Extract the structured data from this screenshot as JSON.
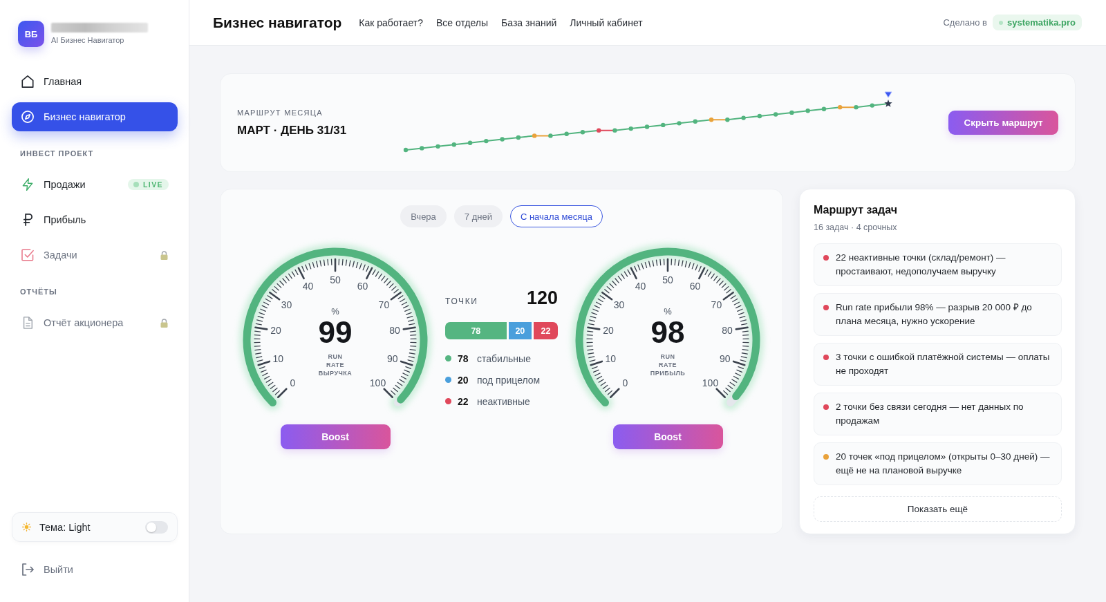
{
  "sidebar": {
    "brand": {
      "initials": "ВБ",
      "subtitle": "AI Бизнес Навигатор"
    },
    "nav": [
      {
        "label": "Главная",
        "selected": false,
        "locked": false
      },
      {
        "label": "Бизнес навигатор",
        "selected": true,
        "locked": false
      }
    ],
    "sections": [
      {
        "title": "ИНВЕСТ ПРОЕКТ",
        "items": [
          {
            "label": "Продажи",
            "selected": false,
            "locked": false,
            "badge": "LIVE"
          },
          {
            "label": "Прибыль",
            "selected": false,
            "locked": false
          },
          {
            "label": "Задачи",
            "selected": false,
            "locked": true
          }
        ]
      },
      {
        "title": "ОТЧЁТЫ",
        "items": [
          {
            "label": "Отчёт акционера",
            "selected": false,
            "locked": true
          }
        ]
      }
    ],
    "theme": {
      "label": "Тема: Light",
      "on": false
    },
    "logout": "Выйти"
  },
  "header": {
    "title": "Бизнес навигатор",
    "links": [
      "Как работает?",
      "Все отделы",
      "База знаний",
      "Личный кабинет"
    ],
    "made_by": "Сделано в",
    "site": "systematika.pro"
  },
  "route": {
    "label": "МАРШРУТ МЕСЯЦА",
    "title": "МАРТ · ДЕНЬ 31/31",
    "days": [
      {
        "color": "#52b47f",
        "current": false
      },
      {
        "color": "#52b47f",
        "current": false
      },
      {
        "color": "#52b47f",
        "current": false
      },
      {
        "color": "#52b47f",
        "current": false
      },
      {
        "color": "#52b47f",
        "current": false
      },
      {
        "color": "#52b47f",
        "current": false
      },
      {
        "color": "#52b47f",
        "current": false
      },
      {
        "color": "#52b47f",
        "current": false
      },
      {
        "color": "#e9a23b",
        "current": false
      },
      {
        "color": "#52b47f",
        "current": false
      },
      {
        "color": "#52b47f",
        "current": false
      },
      {
        "color": "#52b47f",
        "current": false
      },
      {
        "color": "#e0485b",
        "current": false
      },
      {
        "color": "#52b47f",
        "current": false
      },
      {
        "color": "#52b47f",
        "current": false
      },
      {
        "color": "#52b47f",
        "current": false
      },
      {
        "color": "#52b47f",
        "current": false
      },
      {
        "color": "#52b47f",
        "current": false
      },
      {
        "color": "#52b47f",
        "current": false
      },
      {
        "color": "#e9a23b",
        "current": false
      },
      {
        "color": "#52b47f",
        "current": false
      },
      {
        "color": "#52b47f",
        "current": false
      },
      {
        "color": "#52b47f",
        "current": false
      },
      {
        "color": "#52b47f",
        "current": false
      },
      {
        "color": "#52b47f",
        "current": false
      },
      {
        "color": "#52b47f",
        "current": false
      },
      {
        "color": "#52b47f",
        "current": false
      },
      {
        "color": "#e9a23b",
        "current": false
      },
      {
        "color": "#52b47f",
        "current": false
      },
      {
        "color": "#52b47f",
        "current": false
      },
      {
        "color": "#2f3a4d",
        "current": true
      }
    ],
    "button": "Скрыть маршрут"
  },
  "periods": [
    {
      "label": "Вчера",
      "selected": false
    },
    {
      "label": "7 дней",
      "selected": false
    },
    {
      "label": "С начала месяца",
      "selected": true
    }
  ],
  "gauges": [
    {
      "unit": "%",
      "value": "99",
      "caption": "RUN RATE ВЫРУЧКА",
      "level": 0.99,
      "ticks": [
        "0",
        "10",
        "20",
        "30",
        "40",
        "50",
        "60",
        "70",
        "80",
        "90",
        "100"
      ],
      "button": "Boost"
    },
    {
      "unit": "%",
      "value": "98",
      "caption": "RUN RATE ПРИБЫЛЬ",
      "level": 0.98,
      "ticks": [
        "0",
        "10",
        "20",
        "30",
        "40",
        "50",
        "60",
        "70",
        "80",
        "90",
        "100"
      ],
      "button": "Boost"
    }
  ],
  "points": {
    "label": "ТОЧКИ",
    "total": "120",
    "segments": [
      {
        "value": "78",
        "color": "#55b581"
      },
      {
        "value": "20",
        "color": "#4a9fdc"
      },
      {
        "value": "22",
        "color": "#e0485b"
      }
    ],
    "legend": [
      {
        "value": "78",
        "label": "стабильные",
        "color": "#55b581"
      },
      {
        "value": "20",
        "label": "под прицелом",
        "color": "#4a9fdc"
      },
      {
        "value": "22",
        "label": "неактивные",
        "color": "#e0485b"
      }
    ]
  },
  "tasks": {
    "title": "Маршрут задач",
    "subtitle": "16 задач · 4 срочных",
    "items": [
      {
        "text": "22 неактивные точки (склад/ремонт) — простаивают, недополучаем выручку",
        "color": "#e0485b"
      },
      {
        "text": "Run rate прибыли 98% — разрыв 20 000 ₽ до плана месяца, нужно ускорение",
        "color": "#e0485b"
      },
      {
        "text": "3 точки с ошибкой платёжной системы — оплаты не проходят",
        "color": "#e0485b"
      },
      {
        "text": "2 точки без связи сегодня — нет данных по продажам",
        "color": "#e0485b"
      },
      {
        "text": "20 точек «под прицелом» (открыты 0–30 дней) — ещё не на плановой выручке",
        "color": "#e9a23b"
      }
    ],
    "more": "Показать ещё"
  }
}
